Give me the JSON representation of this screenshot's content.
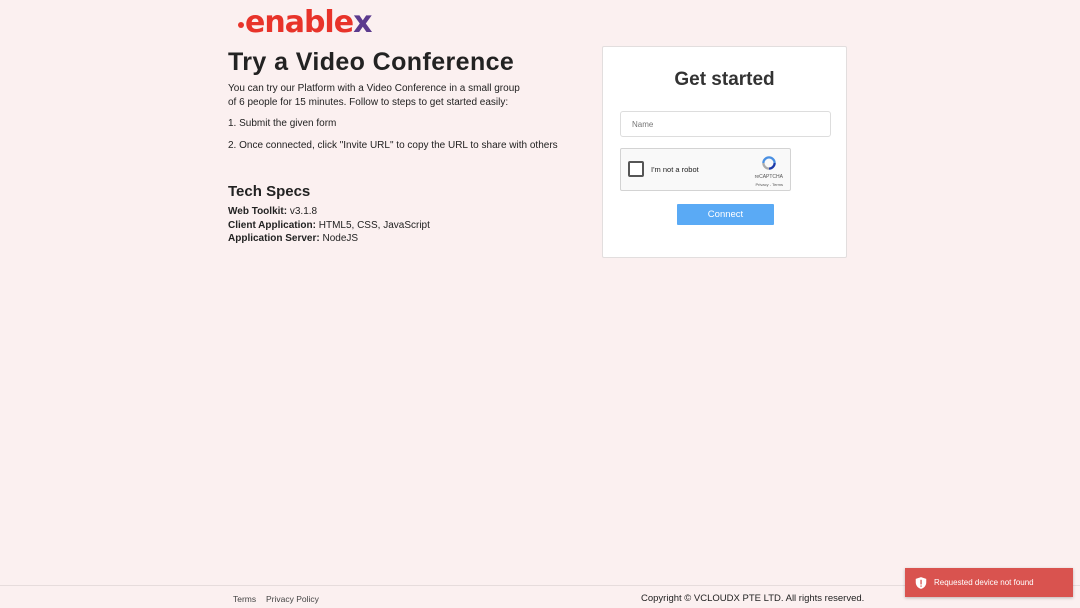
{
  "brand": {
    "logo_main": "enable",
    "logo_x": "x",
    "accent": "#e8332a",
    "secondary": "#5b3a8e"
  },
  "page": {
    "title": "Try a Video Conference",
    "intro": "You can try our Platform with a Video Conference in a small group of 6 people for 15 minutes. Follow to steps to get started easily:",
    "step1": "1. Submit the given form",
    "step2": "2. Once connected, click \"Invite URL\" to copy the URL to share with others"
  },
  "specs": {
    "title": "Tech Specs",
    "items": [
      {
        "label": "Web Toolkit:",
        "value": " v3.1.8"
      },
      {
        "label": "Client Application:",
        "value": " HTML5, CSS, JavaScript"
      },
      {
        "label": "Application Server:",
        "value": " NodeJS"
      }
    ]
  },
  "form": {
    "title": "Get started",
    "name_placeholder": "Name",
    "name_value": "",
    "captcha_label": "I'm not a robot",
    "captcha_brand": "reCAPTCHA",
    "captcha_links": "Privacy - Terms",
    "connect_label": "Connect",
    "button_color": "#5aaaf5"
  },
  "footer": {
    "terms": "Terms",
    "privacy": "Privacy Policy",
    "copyright": "Copyright © VCLOUDX PTE LTD. All rights reserved."
  },
  "toast": {
    "message": "Requested device not found",
    "color": "#d9534f",
    "icon": "shield-alert-icon"
  }
}
